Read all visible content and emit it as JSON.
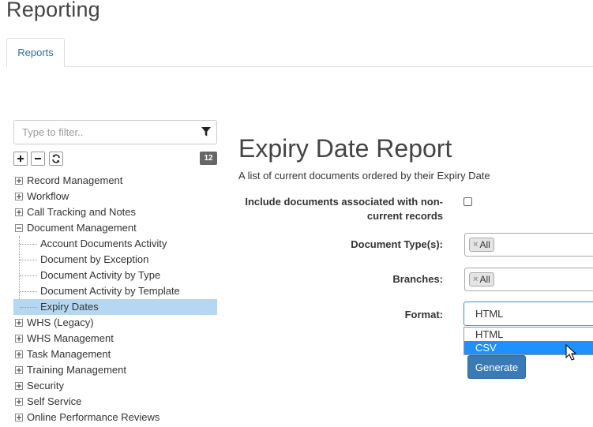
{
  "page": {
    "title": "Reporting"
  },
  "tabs": [
    {
      "label": "Reports"
    }
  ],
  "tree_panel": {
    "filter_placeholder": "Type to filter..",
    "count": "12",
    "items": [
      {
        "label": "Record Management",
        "level": 0,
        "expanded": false
      },
      {
        "label": "Workflow",
        "level": 0,
        "expanded": false
      },
      {
        "label": "Call Tracking and Notes",
        "level": 0,
        "expanded": false
      },
      {
        "label": "Document Management",
        "level": 0,
        "expanded": true
      },
      {
        "label": "Account Documents Activity",
        "level": 1
      },
      {
        "label": "Document by Exception",
        "level": 1
      },
      {
        "label": "Document Activity by Type",
        "level": 1
      },
      {
        "label": "Document Activity by Template",
        "level": 1
      },
      {
        "label": "Expiry Dates",
        "level": 1,
        "selected": true
      },
      {
        "label": "WHS (Legacy)",
        "level": 0,
        "expanded": false
      },
      {
        "label": "WHS Management",
        "level": 0,
        "expanded": false
      },
      {
        "label": "Task Management",
        "level": 0,
        "expanded": false
      },
      {
        "label": "Training Management",
        "level": 0,
        "expanded": false
      },
      {
        "label": "Security",
        "level": 0,
        "expanded": false
      },
      {
        "label": "Self Service",
        "level": 0,
        "expanded": false
      },
      {
        "label": "Online Performance Reviews",
        "level": 0,
        "expanded": false
      }
    ]
  },
  "report": {
    "title": "Expiry Date Report",
    "description": "A list of current documents ordered by their Expiry Date",
    "include_noncurrent_label_line1": "Include documents associated with non-",
    "include_noncurrent_label_line2": "current records",
    "include_noncurrent_checked": false,
    "document_types_label": "Document Type(s):",
    "document_types_chip": "All",
    "branches_label": "Branches:",
    "branches_chip": "All",
    "format_label": "Format:",
    "format_value": "HTML",
    "format_options": [
      "HTML",
      "CSV"
    ],
    "generate_label": "Generate"
  },
  "colors": {
    "accent": "#3a7ab6",
    "selected_row": "#b6d7f2",
    "option_hover": "#1e90ff",
    "tab_text": "#2f6f9f"
  }
}
